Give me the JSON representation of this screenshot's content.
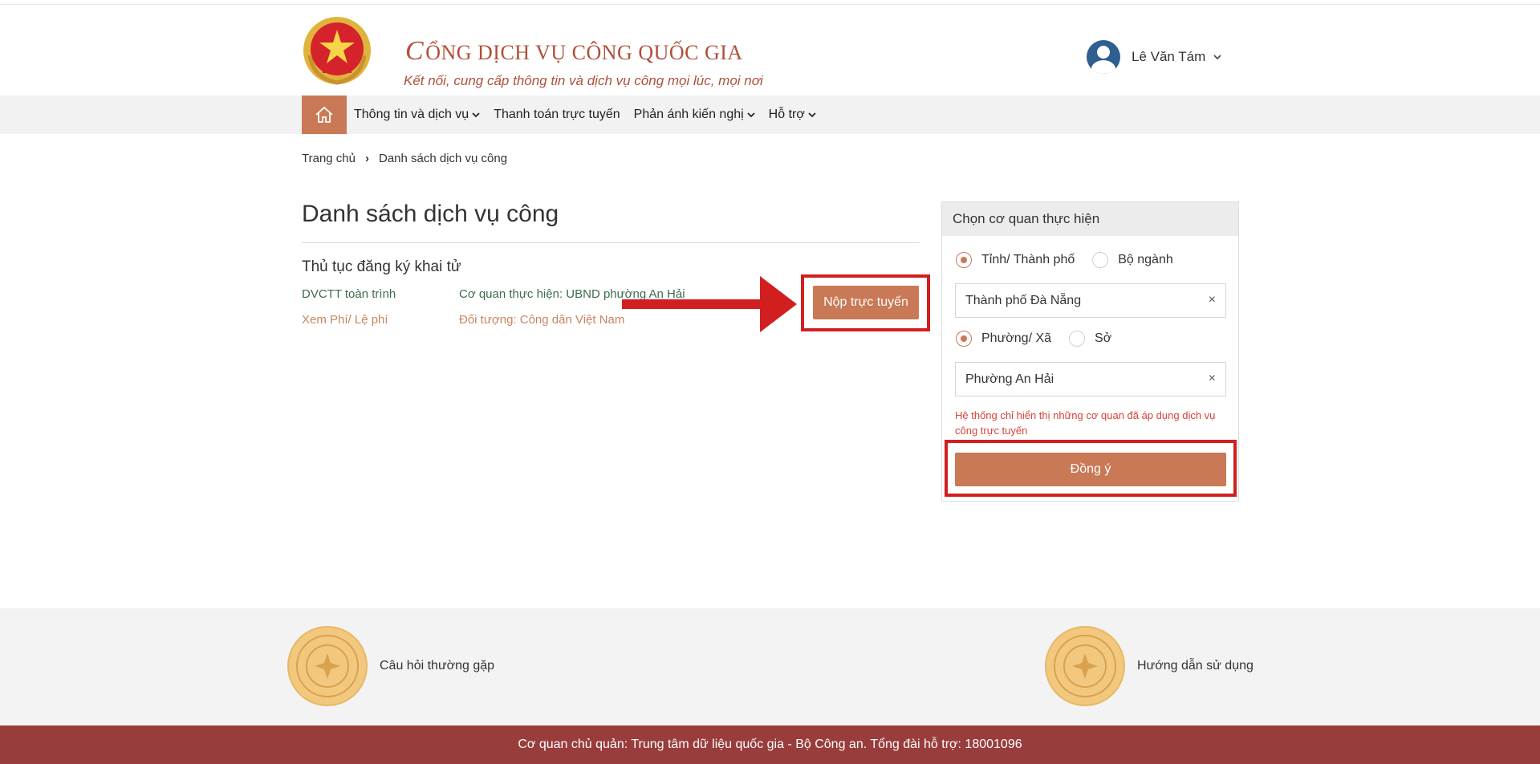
{
  "header": {
    "title": "ỔNG DỊCH VỤ CÔNG QUỐC GIA",
    "title_initial": "C",
    "subtitle": "Kết nối, cung cấp thông tin và dịch vụ công mọi lúc, mọi nơi",
    "user_name": "Lê Văn Tám"
  },
  "nav": {
    "items": [
      {
        "label": "Thông tin và dịch vụ",
        "has_dropdown": true
      },
      {
        "label": "Thanh toán trực tuyến",
        "has_dropdown": false
      },
      {
        "label": "Phản ánh kiến nghị",
        "has_dropdown": true
      },
      {
        "label": "Hỗ trợ",
        "has_dropdown": true
      }
    ]
  },
  "breadcrumb": {
    "home": "Trang chủ",
    "current": "Danh sách dịch vụ công"
  },
  "main": {
    "page_title": "Danh sách dịch vụ công",
    "procedure": {
      "title": "Thủ tục đăng ký khai tử",
      "level": "DVCTT toàn trình",
      "agency": "Cơ quan thực hiện: UBND phường An Hải",
      "fee_link": "Xem Phí/ Lệ phí",
      "target": "Đối tượng: Công dân Việt Nam",
      "submit_label": "Nộp trực tuyến"
    }
  },
  "panel": {
    "title": "Chọn cơ quan thực hiện",
    "level1_options": [
      {
        "label": "Tỉnh/ Thành phố",
        "checked": true
      },
      {
        "label": "Bộ ngành",
        "checked": false
      }
    ],
    "province_value": "Thành phố Đà Nẵng",
    "level2_options": [
      {
        "label": "Phường/ Xã",
        "checked": true
      },
      {
        "label": "Sở",
        "checked": false
      }
    ],
    "ward_value": "Phường An Hải",
    "clear_symbol": "×",
    "notice": "Hệ thống chỉ hiển thị những cơ quan đã áp dụng dịch vụ công trực tuyến",
    "agree_label": "Đồng ý"
  },
  "footer": {
    "faq": "Câu hỏi thường gặp",
    "guide": "Hướng dẫn sử dụng",
    "owner": "Cơ quan chủ quản: Trung tâm dữ liệu quốc gia - Bộ Công an. Tổng đài hỗ trợ: 18001096"
  },
  "colors": {
    "accent": "#c97955",
    "brand": "#b0503a",
    "highlight_frame": "#d11f1f",
    "footer_bar": "#993c3c"
  }
}
